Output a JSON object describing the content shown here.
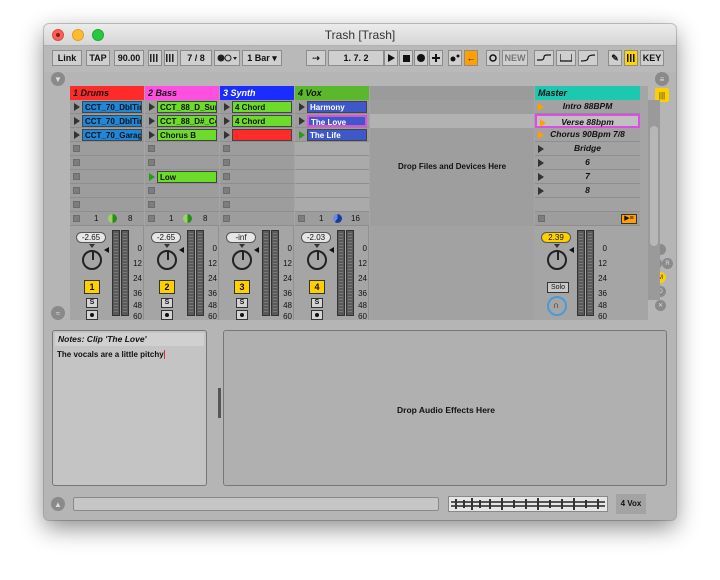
{
  "window": {
    "title": "Trash  [Trash]"
  },
  "control_bar": {
    "link": "Link",
    "tap": "TAP",
    "tempo": "90.00",
    "time_sig_num": "7",
    "time_sig_sep": "/",
    "time_sig_den": "8",
    "quantize": "1 Bar",
    "position": "1.    7.    2",
    "new_label": "NEW",
    "key_label": "KEY"
  },
  "tracks": [
    {
      "name": "1 Drums",
      "color": "#ff2a2a",
      "clips": [
        "CCT_70_DblTim",
        "CCT_70_DblTim",
        "CCT_70_Garage",
        "",
        "",
        "",
        ""
      ],
      "clip_colors": [
        "#1e87d7",
        "#1e87d7",
        "#1e87d7",
        "",
        "",
        "",
        ""
      ],
      "track_num": "1",
      "vol": "-2.65",
      "send_num": "1",
      "send_count": "8"
    },
    {
      "name": "2 Bass",
      "color": "#ff4fe0",
      "clips": [
        "CCT_88_D_Sum",
        "CCT_88_D#_Col",
        "Chorus B",
        "",
        "",
        "Low",
        ""
      ],
      "clip_colors": [
        "#6cdb2a",
        "#6cdb2a",
        "#6cdb2a",
        "",
        "",
        "#6cdb2a",
        ""
      ],
      "track_num": "2",
      "vol": "-2.65",
      "send_num": "1",
      "send_count": "8"
    },
    {
      "name": "3 Synth",
      "color": "#1a2cff",
      "clips": [
        "4 Chord",
        "4 Chord",
        "",
        "",
        "",
        "",
        ""
      ],
      "clip_colors": [
        "#6cdb2a",
        "#6cdb2a",
        "#ff2a2a",
        "",
        "",
        "",
        ""
      ],
      "track_num": "3",
      "vol": "-inf"
    },
    {
      "name": "4 Vox",
      "color": "#5bb82d",
      "clips": [
        "Harmony",
        "The Love",
        "The Life",
        "",
        "",
        "",
        ""
      ],
      "clip_colors": [
        "#3f58c8",
        "#3f58c8",
        "#3f58c8",
        "",
        "",
        "",
        ""
      ],
      "track_num": "4",
      "vol": "-2.03",
      "send_num": "1",
      "send_count": "16"
    }
  ],
  "drop_files": "Drop Files and Devices Here",
  "master": {
    "name": "Master",
    "color": "#1dc8b0",
    "scenes": [
      "Intro  88BPM",
      "Verse 88bpm",
      "Chorus 90Bpm 7/8",
      "Bridge",
      "6",
      "7",
      "8"
    ],
    "vol": "2.39",
    "solo_label": "Solo"
  },
  "meter_scale": [
    "0",
    "12",
    "24",
    "36",
    "48",
    "60"
  ],
  "notes": {
    "title": "Notes: Clip 'The Love'",
    "text": "The vocals are a little pitchy"
  },
  "fx": {
    "drop_msg": "Drop Audio Effects Here"
  },
  "status": {
    "track": "4 Vox"
  }
}
